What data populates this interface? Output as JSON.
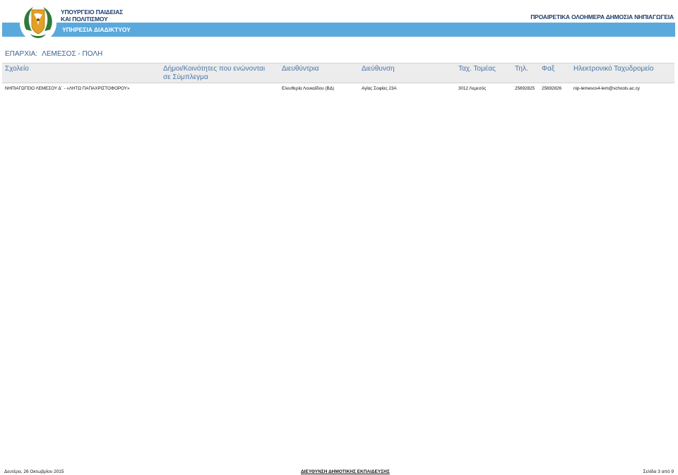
{
  "header": {
    "ministry_line1": "ΥΠΟΥΡΓΕΙΟ ΠΑΙΔΕΙΑΣ",
    "ministry_line2": "ΚΑΙ ΠΟΛΙΤΙΣΜΟΥ",
    "service": "ΥΠΗΡΕΣΙΑ ΔΙΑΔΙΚΤΥΟΥ",
    "report_title": "ΠΡΟΑΙΡΕΤΙΚΑ ΟΛΟΗΜΕΡΑ ΔΗΜΟΣΙΑ ΝΗΠΙΑΓΩΓΕΙΑ",
    "emblem_icon": "cyprus-emblem-icon",
    "band_color": "#5aa9dd"
  },
  "province": {
    "label": "ΕΠΑΡΧΙΑ:",
    "value": "ΛΕΜΕΣΟΣ - ΠΟΛΗ"
  },
  "table": {
    "columns": {
      "school": "Σχολείο",
      "communities": "Δήμοι/Κοινότητες που ενώνονται σε Σύμπλεγμα",
      "director": "Διευθύντρια",
      "address": "Διεύθυνση",
      "postal": "Ταχ. Τομέας",
      "phone": "Τηλ.",
      "fax": "Φαξ",
      "email": "Ηλεκτρονικό Ταχυδρομείο"
    },
    "rows": [
      {
        "school": "ΝΗΠΙΑΓΩΓΕΙΟ ΛΕΜΕΣΟΥ Δ΄ - «ΛΗΤΩ ΠΑΠΑΧΡΙΣΤΟΦΟΡΟΥ»",
        "communities": "",
        "director": "Ελευθερία Λουκαΐδου (ΒΔ)",
        "address": "Αγίας Σοφίας 23Α",
        "postal": "3012 Λεμεσός",
        "phone": "25692825",
        "fax": "25692826",
        "email": "nip-lemesos4-lem@schools.ac.cy"
      }
    ]
  },
  "footer": {
    "date": "Δευτέρα, 26 Οκτωβρίου 2015",
    "department": "ΔΙΕΥΘΥΝΣΗ ΔΗΜΟΤΙΚΗΣ ΕΚΠΑΙΔΕΥΣΗΣ",
    "page": "Σελίδα 3 από 9"
  }
}
